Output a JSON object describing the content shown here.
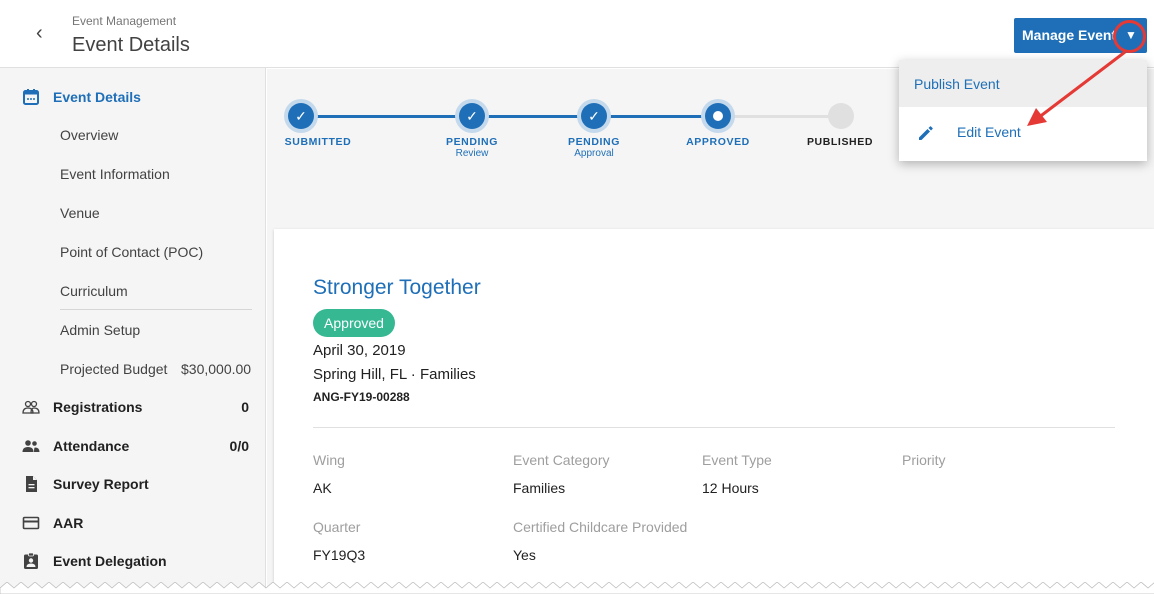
{
  "header": {
    "breadcrumb": "Event Management",
    "title": "Event Details",
    "manage_button": "Manage Event"
  },
  "menu": {
    "items": [
      {
        "label": "Publish Event"
      },
      {
        "label": "Edit Event",
        "icon": "pencil-icon"
      }
    ]
  },
  "sidebar": {
    "event_details": "Event Details",
    "sub_items": [
      "Overview",
      "Event Information",
      "Venue",
      "Point of Contact (POC)",
      "Curriculum",
      "Admin Setup",
      "Projected Budget"
    ],
    "budget_value": "$30,000.00",
    "registrations": {
      "label": "Registrations",
      "count": "0"
    },
    "attendance": {
      "label": "Attendance",
      "count": "0/0"
    },
    "survey": "Survey Report",
    "aar": "AAR",
    "delegation": "Event Delegation"
  },
  "stepper": {
    "steps": [
      {
        "label": "SUBMITTED",
        "sub": "",
        "state": "done"
      },
      {
        "label": "PENDING",
        "sub": "Review",
        "state": "done"
      },
      {
        "label": "PENDING",
        "sub": "Approval",
        "state": "done"
      },
      {
        "label": "APPROVED",
        "sub": "",
        "state": "current"
      },
      {
        "label": "PUBLISHED",
        "sub": "",
        "state": "todo"
      }
    ]
  },
  "event": {
    "title": "Stronger Together",
    "status": "Approved",
    "date": "April 30, 2019",
    "location": "Spring Hill, FL  ·  Families",
    "id": "ANG-FY19-00288"
  },
  "fields": {
    "wing": {
      "label": "Wing",
      "value": "AK"
    },
    "category": {
      "label": "Event Category",
      "value": "Families"
    },
    "type": {
      "label": "Event Type",
      "value": "12 Hours"
    },
    "priority": {
      "label": "Priority",
      "value": ""
    },
    "quarter": {
      "label": "Quarter",
      "value": "FY19Q3"
    },
    "childcare": {
      "label": "Certified Childcare Provided",
      "value": "Yes"
    }
  },
  "colors": {
    "accent": "#1e6fb8",
    "approved_badge": "#36b993",
    "annotation": "#e53935"
  }
}
